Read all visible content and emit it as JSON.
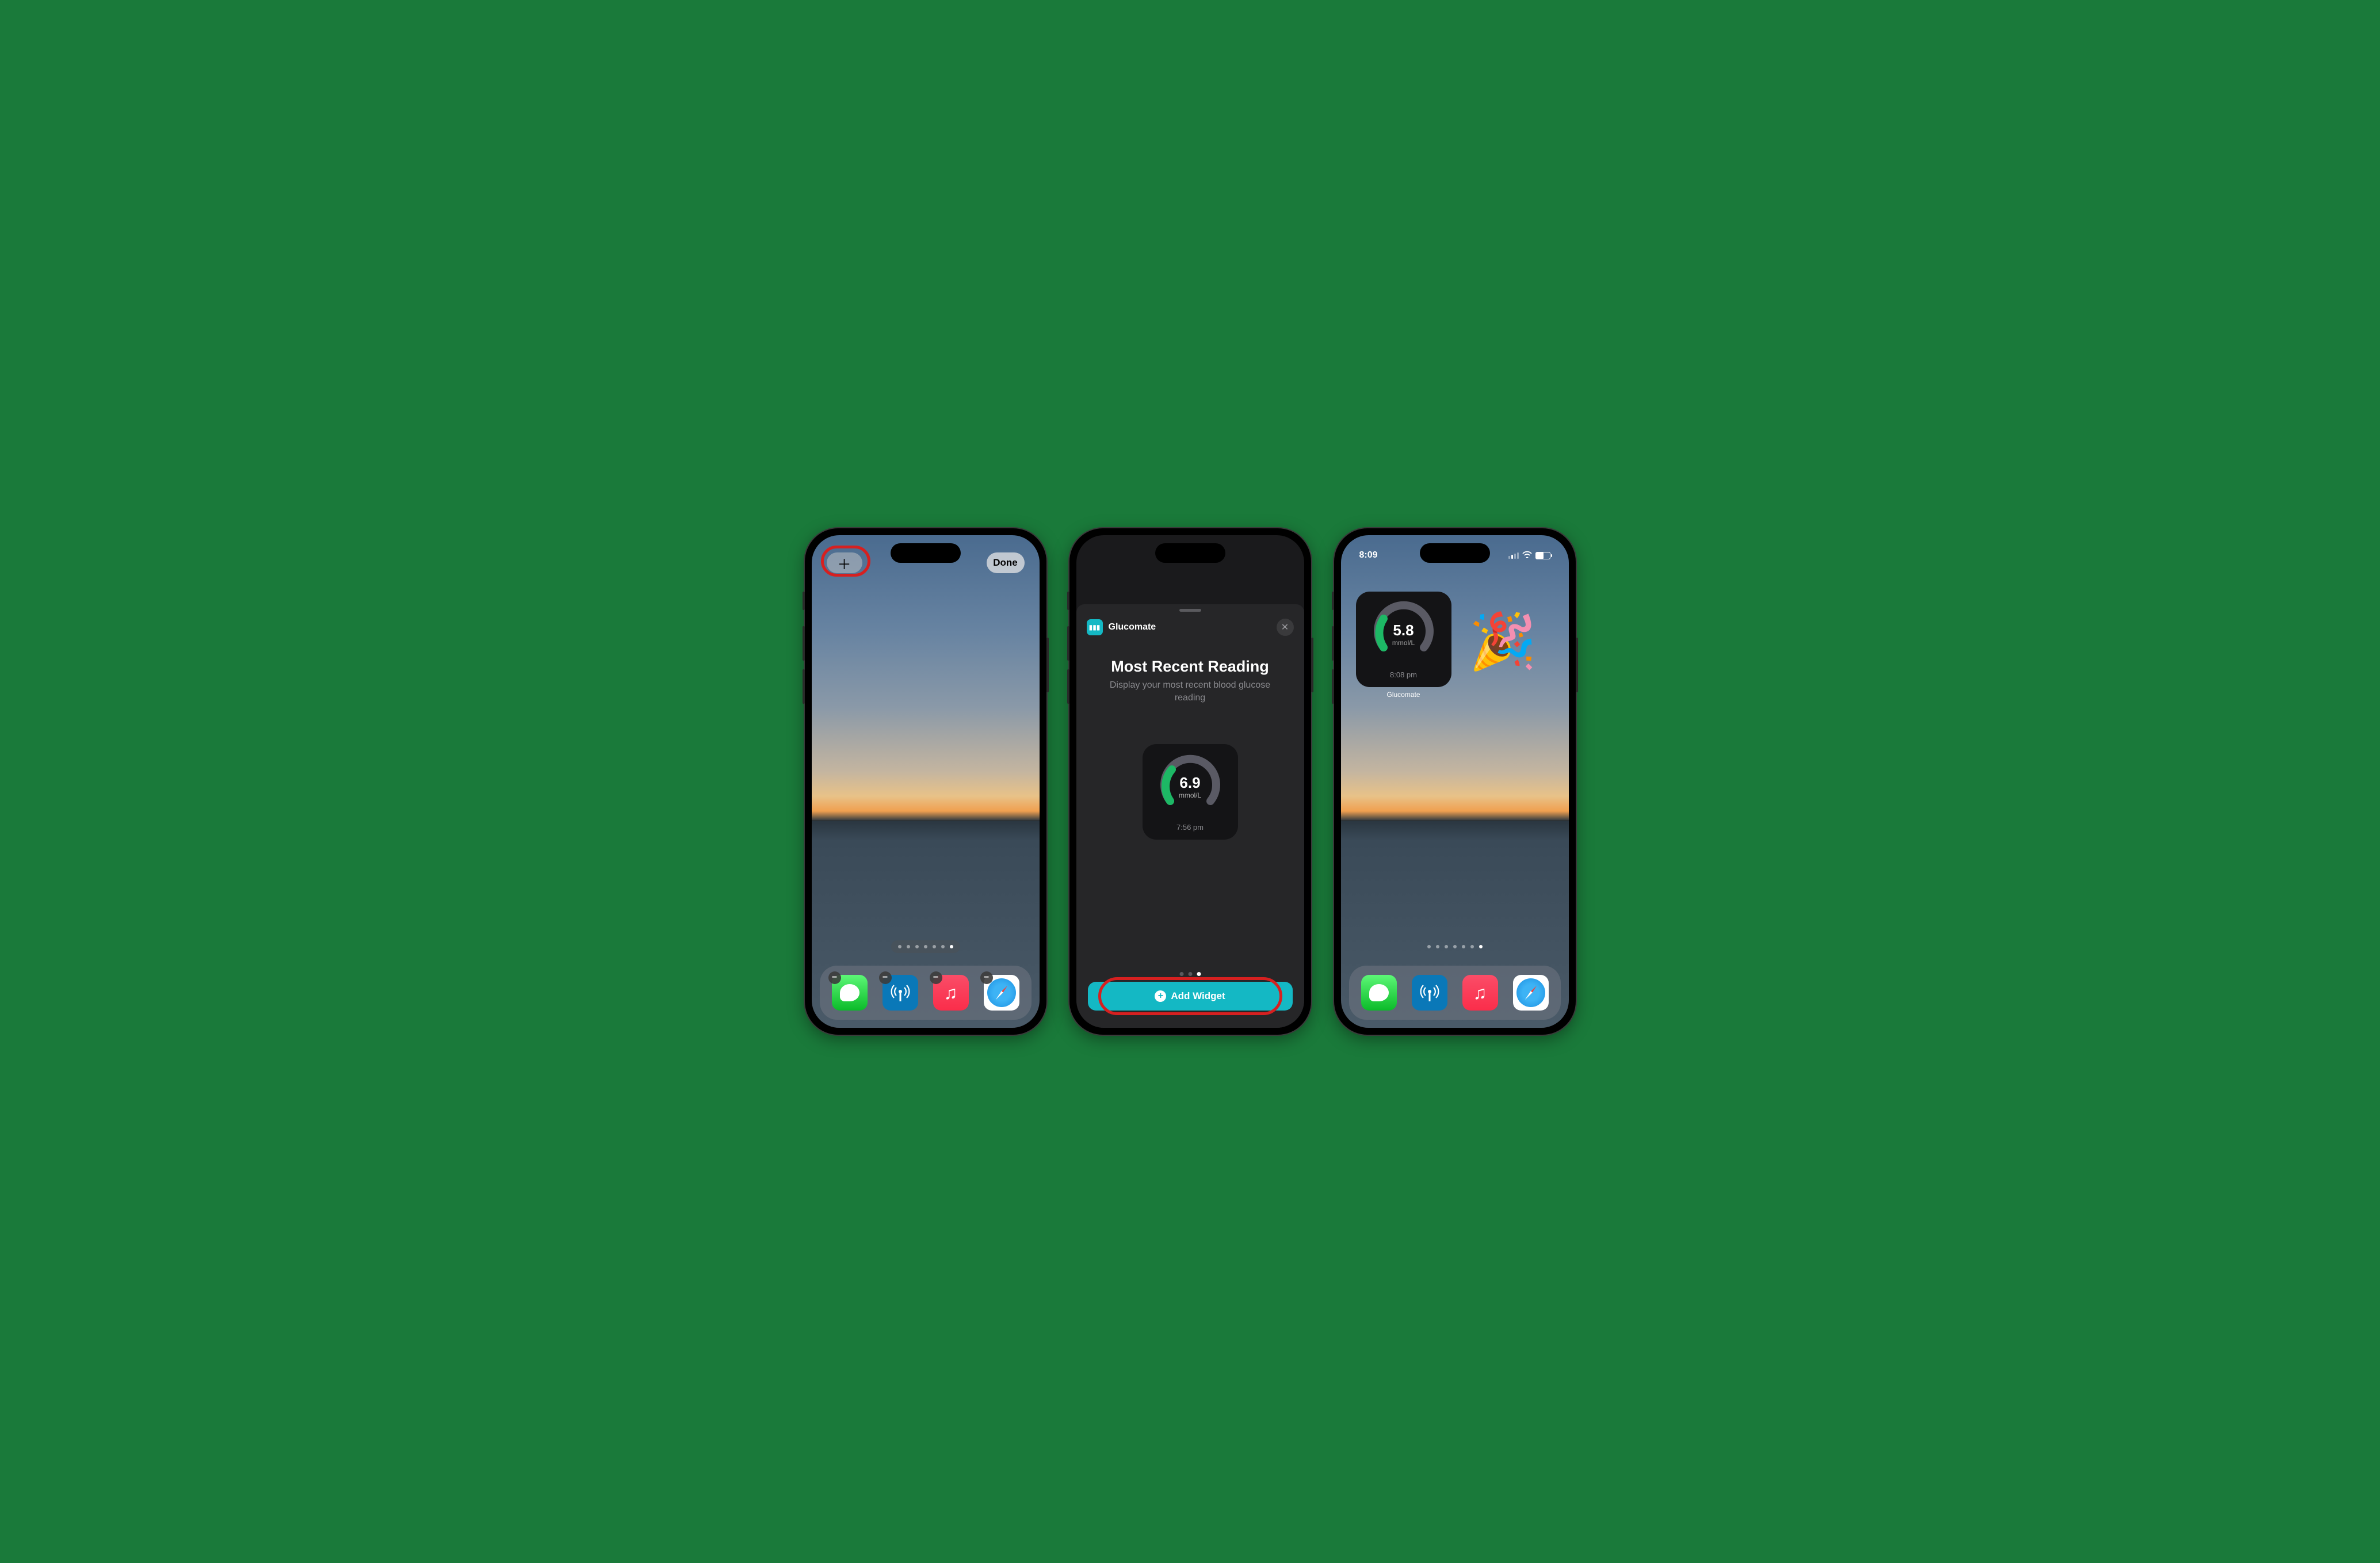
{
  "phone1": {
    "add_icon": "＋",
    "done_label": "Done",
    "page_count": 7,
    "active_page": 6,
    "dock": [
      "Messages",
      "Broadcasts",
      "Music",
      "Safari"
    ]
  },
  "phone2": {
    "app_name": "Glucomate",
    "widget_title": "Most Recent Reading",
    "widget_desc": "Display your most recent blood glucose reading",
    "reading_value": "6.9",
    "reading_unit": "mmol/L",
    "reading_time": "7:56 pm",
    "gallery_pages": 3,
    "gallery_active": 2,
    "add_widget_label": "Add Widget"
  },
  "phone3": {
    "time": "8:09",
    "reading_value": "5.8",
    "reading_unit": "mmol/L",
    "reading_time": "8:08 pm",
    "widget_app_label": "Glucomate",
    "celebration_emoji": "🎉",
    "page_count": 7,
    "active_page": 6
  },
  "colors": {
    "accent": "#14b8c4",
    "gauge_green": "#1db865",
    "gauge_gray": "#5a5a64"
  }
}
